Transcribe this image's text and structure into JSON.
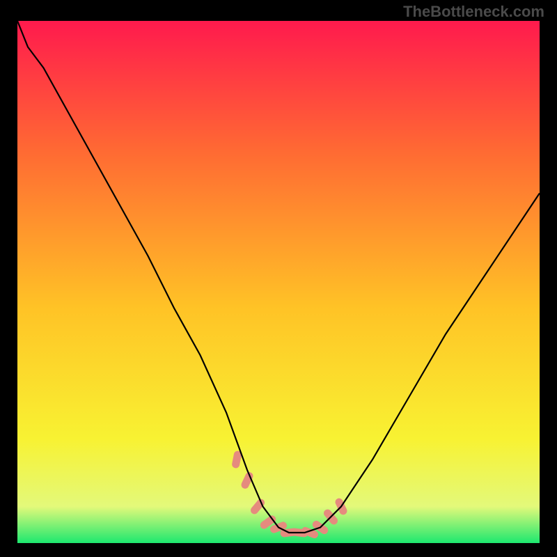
{
  "watermark": "TheBottleneck.com",
  "chart_data": {
    "type": "line",
    "title": "",
    "xlabel": "",
    "ylabel": "",
    "xlim": [
      0,
      100
    ],
    "ylim": [
      0,
      100
    ],
    "grid": false,
    "gradient_stops": [
      {
        "offset": 0,
        "color": "#ff1a4d"
      },
      {
        "offset": 25,
        "color": "#ff6a33"
      },
      {
        "offset": 55,
        "color": "#ffc326"
      },
      {
        "offset": 80,
        "color": "#f8f232"
      },
      {
        "offset": 93,
        "color": "#e3f97a"
      },
      {
        "offset": 100,
        "color": "#1de86f"
      }
    ],
    "series": [
      {
        "name": "bottleneck-curve",
        "color": "#000000",
        "x": [
          0,
          2,
          5,
          10,
          15,
          20,
          25,
          30,
          35,
          40,
          44,
          47,
          50,
          52,
          55,
          58,
          62,
          68,
          75,
          82,
          90,
          100
        ],
        "y": [
          100,
          95,
          91,
          82,
          73,
          64,
          55,
          45,
          36,
          25,
          14,
          7,
          3,
          2,
          2,
          3,
          7,
          16,
          28,
          40,
          52,
          67
        ]
      }
    ],
    "markers": {
      "name": "highlight-region",
      "color": "#e58b7e",
      "x": [
        42,
        44,
        46,
        48,
        50,
        52,
        54,
        56,
        58,
        60,
        62
      ],
      "y": [
        16,
        12,
        7,
        4,
        3,
        2,
        2,
        2,
        3,
        5,
        7
      ]
    }
  }
}
